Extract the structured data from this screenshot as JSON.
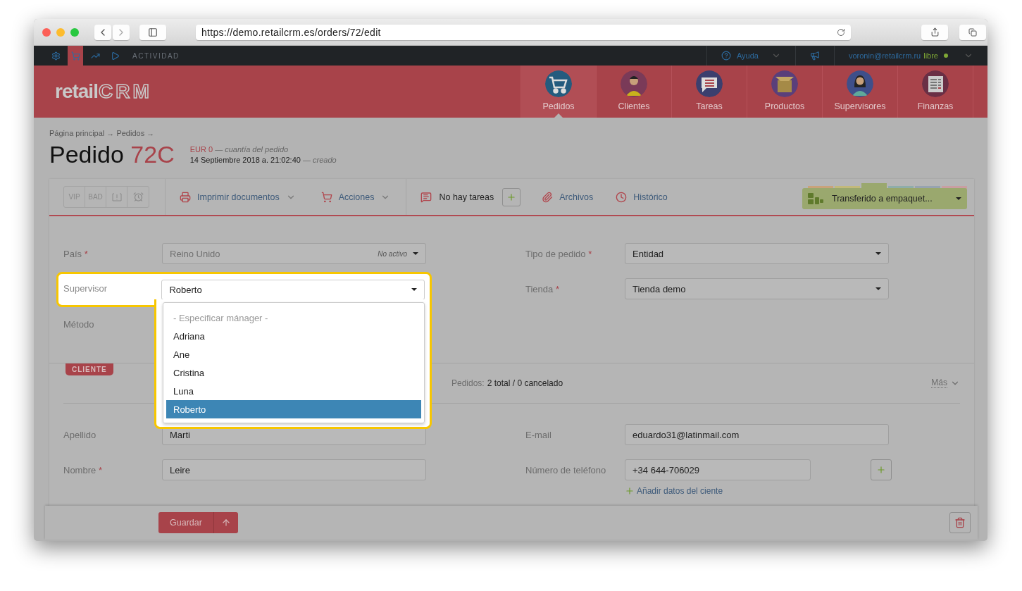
{
  "browser": {
    "url": "https://demo.retailcrm.es/orders/72/edit"
  },
  "top_bar": {
    "icons": [
      {
        "kind": "gear",
        "selected": false
      },
      {
        "kind": "cart",
        "selected": true
      },
      {
        "kind": "chart",
        "selected": false
      },
      {
        "kind": "play",
        "selected": false
      }
    ],
    "activity": "ACTIVIDAD",
    "help": "Ayuda",
    "user": "voronin@retailcrm.ru",
    "plan": "libre"
  },
  "logo": {
    "text_1": "retail",
    "text_2": "CRM"
  },
  "nav": [
    {
      "label": "Pedidos",
      "kind": "cart",
      "selected": true
    },
    {
      "label": "Clientes",
      "kind": "man",
      "selected": false
    },
    {
      "label": "Tareas",
      "kind": "chat",
      "selected": false
    },
    {
      "label": "Productos",
      "kind": "box",
      "selected": false
    },
    {
      "label": "Supervisores",
      "kind": "woman",
      "selected": false
    },
    {
      "label": "Finanzas",
      "kind": "paper",
      "selected": false
    }
  ],
  "breadcrumb": "Página principal → Pedidos →",
  "order": {
    "title": "Pedido",
    "number": "72C",
    "amount": "EUR 0",
    "amount_note": "— cuantía del pedido",
    "created": "14 Septiembre 2018 a. 21:02:40",
    "created_note": "— creado"
  },
  "toolbar": {
    "flags": [
      "VIP",
      "BAD"
    ],
    "print": "Imprimir documentos",
    "actions": "Acciones",
    "tasks": "No hay tareas",
    "files": "Archivos",
    "history": "Histórico",
    "status": {
      "label": "Transferido a empaquet...",
      "steps": [
        {
          "color": "#c9a27a",
          "selected": false
        },
        {
          "color": "#c2b97a",
          "selected": false
        },
        {
          "color": "#9aa86e",
          "selected": true
        },
        {
          "color": "#8fadaa",
          "selected": false
        },
        {
          "color": "#97a3b0",
          "selected": false
        },
        {
          "color": "#c99ea2",
          "selected": false
        }
      ]
    }
  },
  "order_fields": {
    "country": {
      "label": "País",
      "mark": "*",
      "value": "Reino Unido",
      "note": "No activo",
      "disabled": true
    },
    "supervisor": {
      "label": "Supervisor",
      "value": "Roberto",
      "prompt": "- Especificar mánager -",
      "options": [
        {
          "label": "Adriana",
          "selected": false
        },
        {
          "label": "Ane",
          "selected": false
        },
        {
          "label": "Cristina",
          "selected": false
        },
        {
          "label": "Luna",
          "selected": false
        },
        {
          "label": "Roberto",
          "selected": true
        }
      ]
    },
    "method": {
      "label": "Método"
    },
    "order_type": {
      "label": "Tipo de pedido",
      "mark": "*",
      "value": "Entidad"
    },
    "store": {
      "label": "Tienda",
      "mark": "*",
      "value": "Tienda demo"
    }
  },
  "client": {
    "badge": "CLIENTE",
    "orders_label": "Pedidos:",
    "orders_value": "2 total / 0 cancelado",
    "more": "Más",
    "last_name": {
      "label": "Apellido",
      "value": "Marti"
    },
    "first_name": {
      "label": "Nombre",
      "mark": "*",
      "value": "Leire"
    },
    "email": {
      "label": "E-mail",
      "value": "eduardo31@latinmail.com"
    },
    "phone": {
      "label": "Número de teléfono",
      "value": "+34 644-706029"
    },
    "add_data": "Añadir datos del ciente"
  },
  "footer": {
    "save": "Guardar"
  }
}
